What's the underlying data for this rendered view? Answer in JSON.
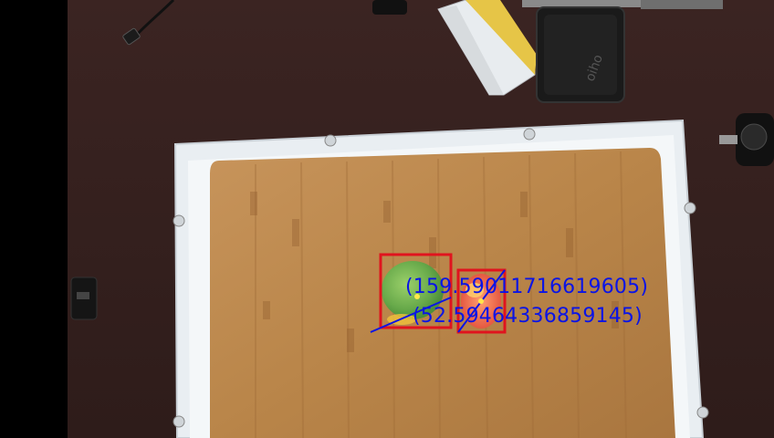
{
  "overlay": {
    "label_color": "#0a14e6",
    "box_color": "#e0141e",
    "center_dot_color": "#ffe84a",
    "labels": [
      "(159.59011716619605)",
      "(52.59464336859145)"
    ]
  },
  "scene": {
    "objects": [
      "tray",
      "cutting-board",
      "green-apple",
      "red-fruit",
      "yellow-sponge",
      "black-case",
      "usb-cable",
      "power-adapter"
    ]
  }
}
